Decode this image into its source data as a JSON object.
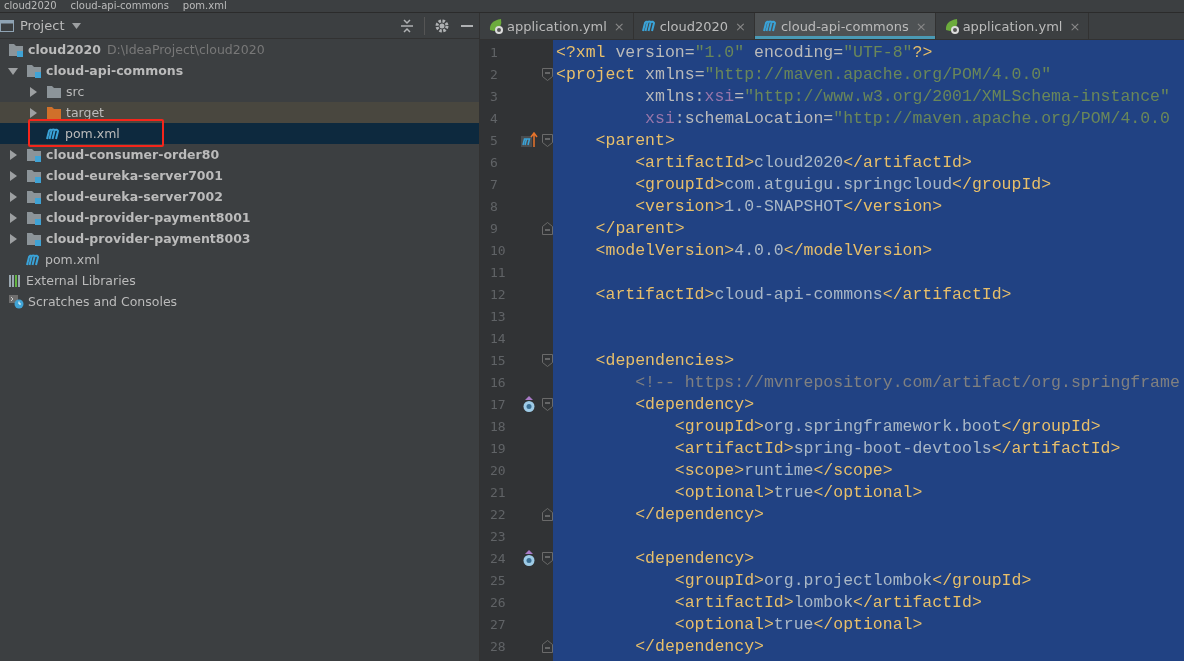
{
  "breadcrumbs": [
    "cloud2020",
    "cloud-api-commons",
    "pom.xml"
  ],
  "project_panel": {
    "title": "Project",
    "tree": [
      {
        "label": "cloud2020",
        "path": "D:\\IdeaProject\\cloud2020",
        "kind": "module",
        "expanded": true,
        "selected": false,
        "hovered": false,
        "children": [
          {
            "label": "cloud-api-commons",
            "kind": "module",
            "expanded": true,
            "selected": false,
            "hovered": false,
            "children": [
              {
                "label": "src",
                "kind": "folder",
                "expanded": false,
                "selected": false,
                "hovered": false
              },
              {
                "label": "target",
                "kind": "excluded",
                "expanded": false,
                "selected": false,
                "hovered": true
              },
              {
                "label": "pom.xml",
                "kind": "maven",
                "selected": true,
                "hovered": false
              }
            ]
          },
          {
            "label": "cloud-consumer-order80",
            "kind": "module",
            "expanded": false,
            "selected": false,
            "hovered": false
          },
          {
            "label": "cloud-eureka-server7001",
            "kind": "module",
            "expanded": false,
            "selected": false,
            "hovered": false
          },
          {
            "label": "cloud-eureka-server7002",
            "kind": "module",
            "expanded": false,
            "selected": false,
            "hovered": false
          },
          {
            "label": "cloud-provider-payment8001",
            "kind": "module",
            "expanded": false,
            "selected": false,
            "hovered": false
          },
          {
            "label": "cloud-provider-payment8003",
            "kind": "module",
            "expanded": false,
            "selected": false,
            "hovered": false
          },
          {
            "label": "pom.xml",
            "kind": "maven",
            "selected": false,
            "hovered": false
          }
        ]
      },
      {
        "label": "External Libraries",
        "kind": "libraries",
        "selected": false,
        "hovered": false
      },
      {
        "label": "Scratches and Consoles",
        "kind": "scratches",
        "selected": false,
        "hovered": false
      }
    ]
  },
  "tabs": [
    {
      "label": "application.yml",
      "kind": "spring",
      "selected": false,
      "close": "×"
    },
    {
      "label": "cloud2020",
      "kind": "maven",
      "selected": false,
      "close": "×"
    },
    {
      "label": "cloud-api-commons",
      "kind": "maven",
      "selected": true,
      "close": "×"
    },
    {
      "label": "application.yml",
      "kind": "spring",
      "selected": false,
      "close": "×"
    }
  ],
  "editor": {
    "all_selected": true,
    "lines": [
      {
        "number": "1",
        "segments": [
          {
            "text": "<?xml",
            "kind": "tag"
          },
          {
            "text": " version=",
            "kind": "attr"
          },
          {
            "text": "\"1.0\"",
            "kind": "value"
          },
          {
            "text": " encoding=",
            "kind": "attr"
          },
          {
            "text": "\"UTF-8\"",
            "kind": "value"
          },
          {
            "text": "?>",
            "kind": "tag"
          }
        ]
      },
      {
        "number": "2",
        "fold": {
          "kind": "open"
        },
        "segments": [
          {
            "text": "<project",
            "kind": "tag"
          },
          {
            "text": " xmlns=",
            "kind": "attr"
          },
          {
            "text": "\"http://maven.apache.org/POM/4.0.0\"",
            "kind": "value"
          }
        ]
      },
      {
        "number": "3",
        "segments": [
          {
            "text": "         xmlns:",
            "kind": "attr"
          },
          {
            "text": "xsi",
            "kind": "ns"
          },
          {
            "text": "=",
            "kind": "attr"
          },
          {
            "text": "\"http://www.w3.org/2001/XMLSchema-instance\"",
            "kind": "value"
          }
        ]
      },
      {
        "number": "4",
        "segments": [
          {
            "text": "         xsi",
            "kind": "ns"
          },
          {
            "text": ":schemaLocation=",
            "kind": "attr"
          },
          {
            "text": "\"http://maven.apache.org/POM/4.0.0",
            "kind": "value"
          }
        ]
      },
      {
        "number": "5",
        "marker": {
          "kind": "maven"
        },
        "fold": {
          "kind": "open"
        },
        "segments": [
          {
            "text": "    <parent>",
            "kind": "tag"
          }
        ]
      },
      {
        "number": "6",
        "segments": [
          {
            "text": "        <artifactId>",
            "kind": "tag"
          },
          {
            "text": "cloud2020",
            "kind": "text"
          },
          {
            "text": "</artifactId>",
            "kind": "tag"
          }
        ]
      },
      {
        "number": "7",
        "segments": [
          {
            "text": "        <groupId>",
            "kind": "tag"
          },
          {
            "text": "com.atguigu.springcloud",
            "kind": "text"
          },
          {
            "text": "</groupId>",
            "kind": "tag"
          }
        ]
      },
      {
        "number": "8",
        "segments": [
          {
            "text": "        <version>",
            "kind": "tag"
          },
          {
            "text": "1.0-SNAPSHOT",
            "kind": "text"
          },
          {
            "text": "</version>",
            "kind": "tag"
          }
        ]
      },
      {
        "number": "9",
        "fold": {
          "kind": "close"
        },
        "segments": [
          {
            "text": "    </parent>",
            "kind": "tag"
          }
        ]
      },
      {
        "number": "10",
        "segments": [
          {
            "text": "    <modelVersion>",
            "kind": "tag"
          },
          {
            "text": "4.0.0",
            "kind": "text"
          },
          {
            "text": "</modelVersion>",
            "kind": "tag"
          }
        ]
      },
      {
        "number": "11"
      },
      {
        "number": "12",
        "segments": [
          {
            "text": "    <artifactId>",
            "kind": "tag"
          },
          {
            "text": "cloud-api-commons",
            "kind": "text"
          },
          {
            "text": "</artifactId>",
            "kind": "tag"
          }
        ]
      },
      {
        "number": "13"
      },
      {
        "number": "14"
      },
      {
        "number": "15",
        "fold": {
          "kind": "open"
        },
        "segments": [
          {
            "text": "    <dependencies>",
            "kind": "tag"
          }
        ]
      },
      {
        "number": "16",
        "segments": [
          {
            "text": "        <!-- https://mvnrepository.com/artifact/org.springframe",
            "kind": "comment"
          }
        ]
      },
      {
        "number": "17",
        "marker": {
          "kind": "dependency"
        },
        "fold": {
          "kind": "open"
        },
        "segments": [
          {
            "text": "        <dependency>",
            "kind": "tag"
          }
        ]
      },
      {
        "number": "18",
        "segments": [
          {
            "text": "            <groupId>",
            "kind": "tag"
          },
          {
            "text": "org.springframework.boot",
            "kind": "text"
          },
          {
            "text": "</groupId>",
            "kind": "tag"
          }
        ]
      },
      {
        "number": "19",
        "segments": [
          {
            "text": "            <artifactId>",
            "kind": "tag"
          },
          {
            "text": "spring-boot-devtools",
            "kind": "text"
          },
          {
            "text": "</artifactId>",
            "kind": "tag"
          }
        ]
      },
      {
        "number": "20",
        "segments": [
          {
            "text": "            <scope>",
            "kind": "tag"
          },
          {
            "text": "runtime",
            "kind": "text"
          },
          {
            "text": "</scope>",
            "kind": "tag"
          }
        ]
      },
      {
        "number": "21",
        "segments": [
          {
            "text": "            <optional>",
            "kind": "tag"
          },
          {
            "text": "true",
            "kind": "text"
          },
          {
            "text": "</optional>",
            "kind": "tag"
          }
        ]
      },
      {
        "number": "22",
        "fold": {
          "kind": "close"
        },
        "segments": [
          {
            "text": "        </dependency>",
            "kind": "tag"
          }
        ]
      },
      {
        "number": "23"
      },
      {
        "number": "24",
        "marker": {
          "kind": "dependency"
        },
        "fold": {
          "kind": "open"
        },
        "segments": [
          {
            "text": "        <dependency>",
            "kind": "tag"
          }
        ]
      },
      {
        "number": "25",
        "segments": [
          {
            "text": "            <groupId>",
            "kind": "tag"
          },
          {
            "text": "org.projectlombok",
            "kind": "text"
          },
          {
            "text": "</groupId>",
            "kind": "tag"
          }
        ]
      },
      {
        "number": "26",
        "segments": [
          {
            "text": "            <artifactId>",
            "kind": "tag"
          },
          {
            "text": "lombok",
            "kind": "text"
          },
          {
            "text": "</artifactId>",
            "kind": "tag"
          }
        ]
      },
      {
        "number": "27",
        "segments": [
          {
            "text": "            <optional>",
            "kind": "tag"
          },
          {
            "text": "true",
            "kind": "text"
          },
          {
            "text": "</optional>",
            "kind": "tag"
          }
        ]
      },
      {
        "number": "28",
        "fold": {
          "kind": "close"
        },
        "segments": [
          {
            "text": "        </dependency>",
            "kind": "tag"
          }
        ]
      }
    ]
  }
}
